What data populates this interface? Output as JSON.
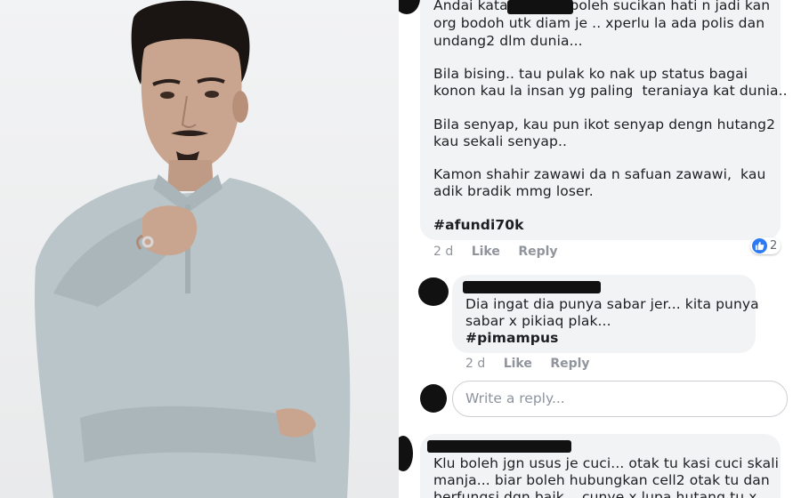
{
  "comments": [
    {
      "lines": [
        "Andai kata          ni boleh sucikan hati n jadi kan",
        "org bodoh utk diam je .. xperlu la ada polis dan",
        "undang2 dlm dunia...",
        "",
        "Bila bising.. tau pulak ko nak up status bagai",
        "konon kau la insan yg paling  teraniaya kat dunia..",
        "",
        "Bila senyap, kau pun ikot senyap dengn hutang2",
        "kau sekali senyap..",
        "",
        "Kamon shahir zawawi da n safuan zawawi,  kau",
        "adik bradik mmg loser.",
        "",
        "#afundi70k"
      ],
      "time": "2 d",
      "like_label": "Like",
      "reply_label": "Reply",
      "reaction_count": "2",
      "reaction_icon": "thumbs-up-icon",
      "reply": {
        "lines": [
          "Dia ingat dia punya sabar jer... kita punya",
          "sabar x pikiaq plak...",
          "#pimampus"
        ],
        "time": "2 d",
        "like_label": "Like",
        "reply_label": "Reply"
      },
      "reply_input_placeholder": "Write a reply..."
    },
    {
      "lines": [
        "Klu boleh jgn usus je cuci... otak tu kasi cuci skali",
        "manja... biar boleh hubungkan cell2 otak tu dan",
        "berfungsi dgn baik... cunye x lupa hutang tu x"
      ]
    }
  ],
  "colors": {
    "bubble": "#f2f3f5",
    "meta_text": "#90949c",
    "like_badge": "#2d7bf4",
    "shirt": "#b9c5c9"
  }
}
